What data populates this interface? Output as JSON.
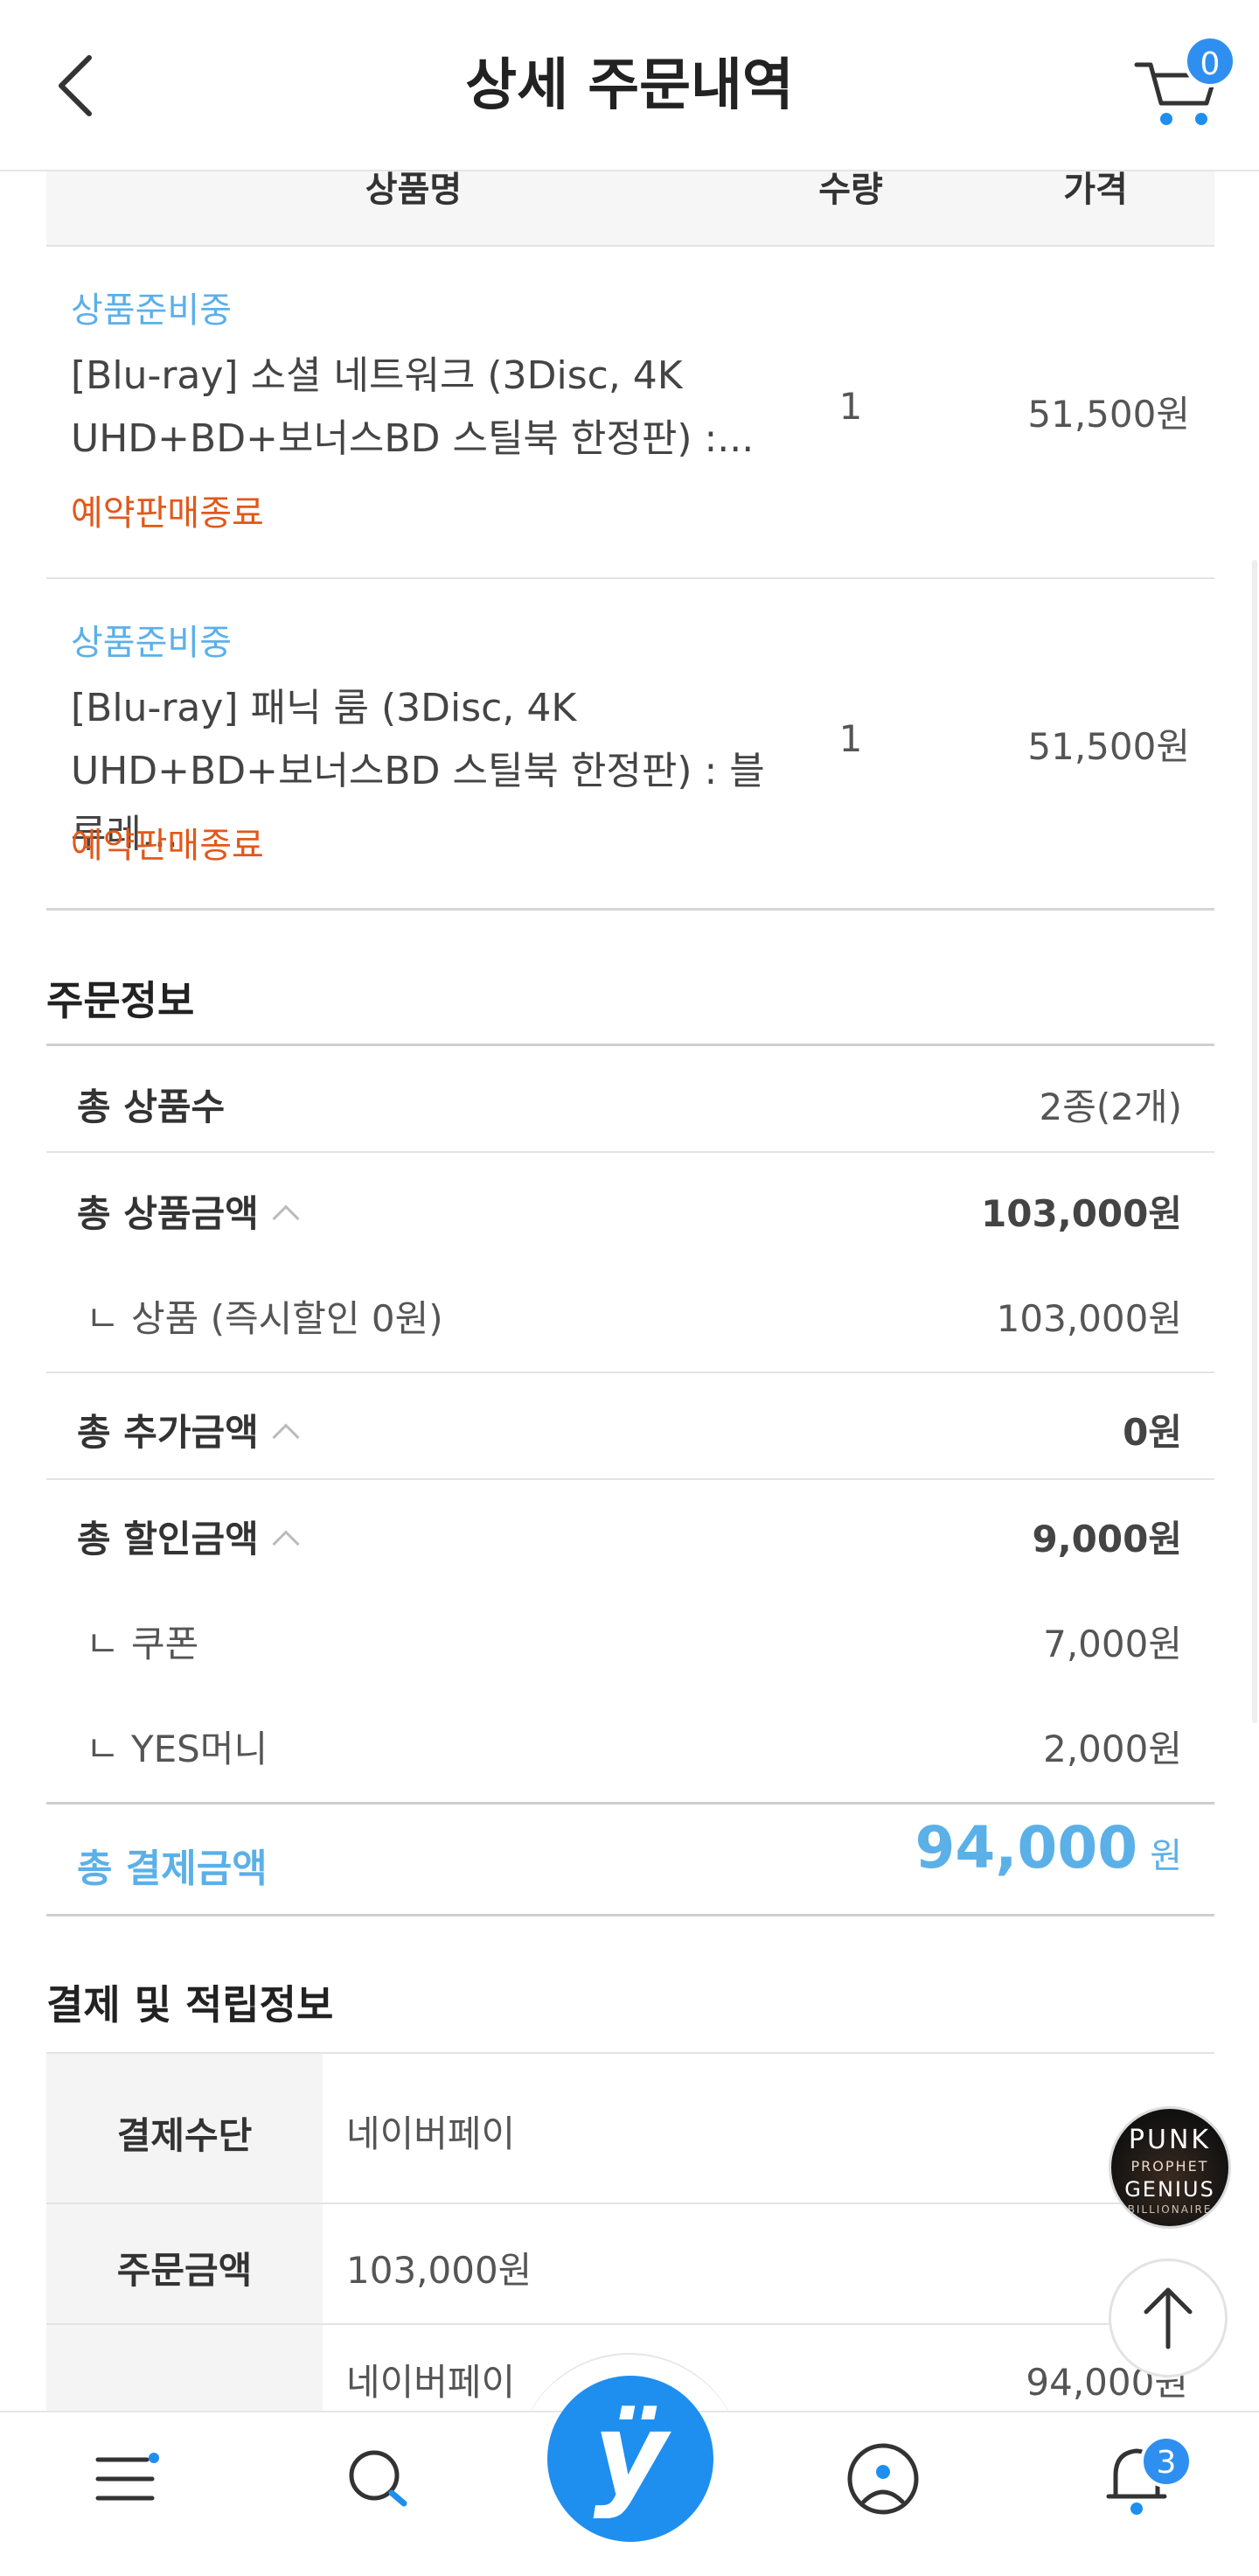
{
  "header": {
    "title": "상세 주문내역",
    "cart_count": "0"
  },
  "table_header": {
    "name": "상품명",
    "qty": "수량",
    "price": "가격"
  },
  "products": [
    {
      "status": "상품준비중",
      "title": "[Blu-ray] 소셜 네트워크 (3Disc, 4K UHD+BD+보너스BD 스틸북 한정판) :...",
      "tag": "예약판매종료",
      "qty": "1",
      "price": "51,500원"
    },
    {
      "status": "상품준비중",
      "title": "[Blu-ray] 패닉 룸 (3Disc, 4K UHD+BD+보너스BD 스틸북 한정판) : 블루레...",
      "tag": "예약판매종료",
      "qty": "1",
      "price": "51,500원"
    }
  ],
  "order_info": {
    "title": "주문정보",
    "total_items_label": "총 상품수",
    "total_items_value": "2종(2개)",
    "total_product_label": "총 상품금액",
    "total_product_value": "103,000원",
    "product_sub_label": "ㄴ 상품 (즉시할인 0원)",
    "product_sub_value": "103,000원",
    "total_extra_label": "총 추가금액",
    "total_extra_value": "0원",
    "total_discount_label": "총 할인금액",
    "total_discount_value": "9,000원",
    "coupon_label": "ㄴ 쿠폰",
    "coupon_value": "7,000원",
    "yesmoney_label": "ㄴ YES머니",
    "yesmoney_value": "2,000원",
    "total_payment_label": "총 결제금액",
    "total_payment_value": "94,000",
    "total_payment_unit": "원"
  },
  "payment_info": {
    "title": "결제 및 적립정보",
    "method_label": "결제수단",
    "method_value": "네이버페이",
    "order_amount_label": "주문금액",
    "order_amount_value": "103,000원",
    "paid_method": "네이버페이",
    "paid_amount": "94,000원"
  },
  "floating": {
    "badge_line1": "PUNK",
    "badge_line2": "PROPHET",
    "badge_line3": "GENIUS",
    "badge_line4": "BILLIONAIRE"
  },
  "bottom_nav": {
    "center_logo": "ÿ",
    "notification_count": "3"
  }
}
